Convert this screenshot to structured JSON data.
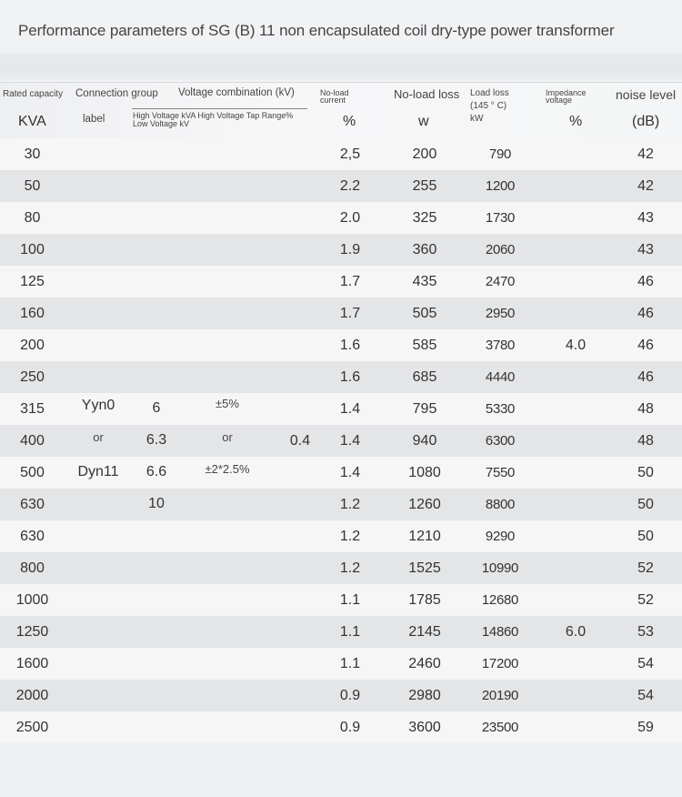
{
  "title": "Performance parameters of SG (B) 11 non encapsulated coil dry-type power transformer",
  "header": {
    "rated_capacity": "Rated capacity",
    "rated_capacity_unit": "KVA",
    "connection_group": "Connection group",
    "connection_label": "label",
    "voltage_combination": "Voltage combination (kV)",
    "voltage_sub": "High Voltage kVA High Voltage Tap Range%",
    "voltage_sub2": "Low Voltage kV",
    "no_load_current_1": "No-load",
    "no_load_current_2": "current",
    "no_load_current_unit": "%",
    "no_load_loss": "No-load loss",
    "no_load_loss_unit": "w",
    "load_loss_1": "Load loss",
    "load_loss_2": "(145 ° C)",
    "load_loss_unit": "kW",
    "impedance_1": "Impedance",
    "impedance_2": "voltage",
    "impedance_unit": "%",
    "noise": "noise level",
    "noise_unit": "(dB)"
  },
  "merged": {
    "connection": [
      "Yyn0",
      "or",
      "Dyn11"
    ],
    "hv": [
      "6",
      "6.3",
      "6.6",
      "10"
    ],
    "tap": [
      "±5%",
      "or",
      "±2*2.5%"
    ],
    "lv": "0.4",
    "impedance_a": "4.0",
    "impedance_b": "6.0"
  },
  "rows": [
    {
      "cap": "30",
      "cur": "2,5",
      "nll": "200",
      "ll": "790",
      "noise": "42"
    },
    {
      "cap": "50",
      "cur": "2.2",
      "nll": "255",
      "ll": "1200",
      "noise": "42"
    },
    {
      "cap": "80",
      "cur": "2.0",
      "nll": "325",
      "ll": "1730",
      "noise": "43"
    },
    {
      "cap": "100",
      "cur": "1.9",
      "nll": "360",
      "ll": "2060",
      "noise": "43"
    },
    {
      "cap": "125",
      "cur": "1.7",
      "nll": "435",
      "ll": "2470",
      "noise": "46"
    },
    {
      "cap": "160",
      "cur": "1.7",
      "nll": "505",
      "ll": "2950",
      "noise": "46"
    },
    {
      "cap": "200",
      "cur": "1.6",
      "nll": "585",
      "ll": "3780",
      "noise": "46"
    },
    {
      "cap": "250",
      "cur": "1.6",
      "nll": "685",
      "ll": "4440",
      "noise": "46"
    },
    {
      "cap": "315",
      "cur": "1.4",
      "nll": "795",
      "ll": "5330",
      "noise": "48"
    },
    {
      "cap": "400",
      "cur": "1.4",
      "nll": "940",
      "ll": "6300",
      "noise": "48"
    },
    {
      "cap": "500",
      "cur": "1.4",
      "nll": "1080",
      "ll": "7550",
      "noise": "50"
    },
    {
      "cap": "630",
      "cur": "1.2",
      "nll": "1260",
      "ll": "8800",
      "noise": "50"
    },
    {
      "cap": "630",
      "cur": "1.2",
      "nll": "1210",
      "ll": "9290",
      "noise": "50"
    },
    {
      "cap": "800",
      "cur": "1.2",
      "nll": "1525",
      "ll": "10990",
      "noise": "52"
    },
    {
      "cap": "1000",
      "cur": "1.1",
      "nll": "1785",
      "ll": "12680",
      "noise": "52"
    },
    {
      "cap": "1250",
      "cur": "1.1",
      "nll": "2145",
      "ll": "14860",
      "noise": "53"
    },
    {
      "cap": "1600",
      "cur": "1.1",
      "nll": "2460",
      "ll": "17200",
      "noise": "54"
    },
    {
      "cap": "2000",
      "cur": "0.9",
      "nll": "2980",
      "ll": "20190",
      "noise": "54"
    },
    {
      "cap": "2500",
      "cur": "0.9",
      "nll": "3600",
      "ll": "23500",
      "noise": "59"
    }
  ]
}
